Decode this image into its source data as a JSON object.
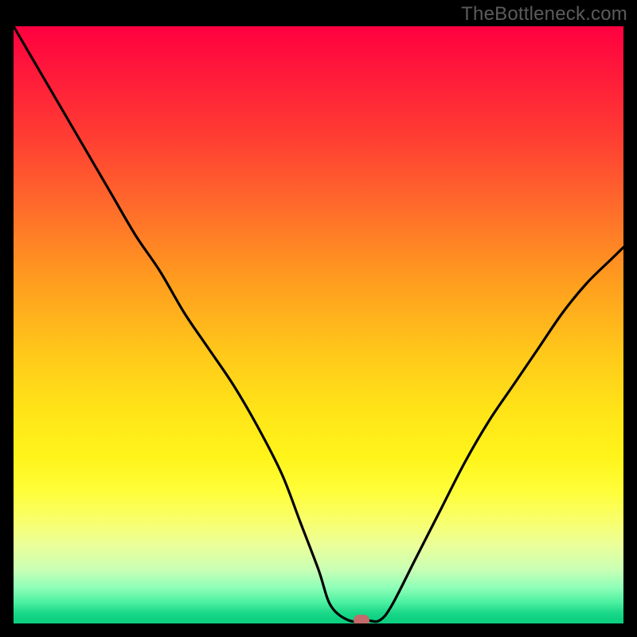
{
  "watermark": "TheBottleneck.com",
  "chart_data": {
    "type": "line",
    "title": "",
    "xlabel": "",
    "ylabel": "",
    "xlim": [
      0,
      100
    ],
    "ylim": [
      0,
      100
    ],
    "curve": {
      "x": [
        0,
        4,
        8,
        12,
        16,
        20,
        24,
        28,
        32,
        36,
        40,
        44,
        47,
        50,
        52,
        55,
        58,
        60,
        62,
        66,
        70,
        74,
        78,
        82,
        86,
        90,
        94,
        98,
        100
      ],
      "y": [
        100,
        93,
        86,
        79,
        72,
        65,
        59,
        52,
        46,
        40,
        33,
        25,
        17,
        9,
        3,
        0.5,
        0.5,
        0.5,
        3,
        11,
        19,
        27,
        34,
        40,
        46,
        52,
        57,
        61,
        63
      ]
    },
    "marker": {
      "x": 57,
      "y": 0.5
    },
    "colors": {
      "top": "#ff0040",
      "mid": "#ffe318",
      "bottom": "#0ccf80",
      "curve": "#000000",
      "marker": "#c26b6b",
      "frame": "#000000"
    }
  }
}
